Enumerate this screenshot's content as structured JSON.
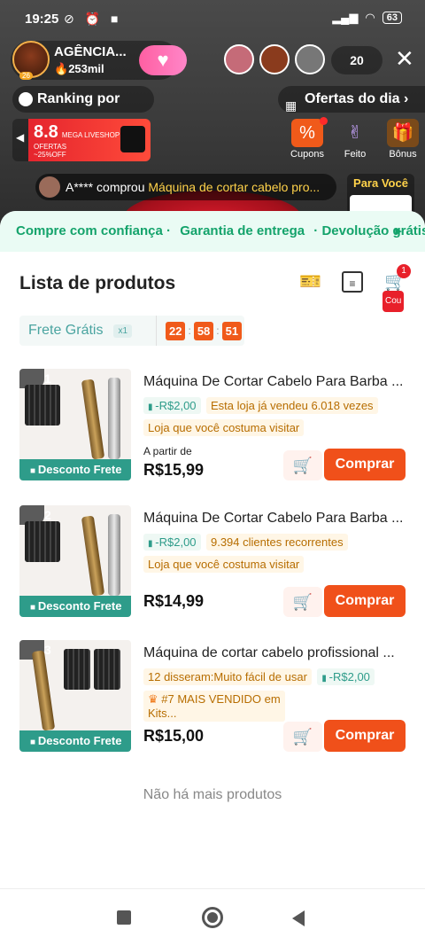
{
  "status": {
    "time": "19:25",
    "battery": "63"
  },
  "live": {
    "host_name": "AGÊNCIA...",
    "host_level": "26",
    "views": "253mil",
    "viewer_count": "20",
    "ranking_label": "Ranking por Hora",
    "offers_label": "Ofertas do dia",
    "banner": {
      "line1": "8.8",
      "line2": "MEGA LIVESHOP DE OFERTAS",
      "line3": "~25%OFF"
    },
    "tiles": [
      {
        "label": "Cupons",
        "icon": "%"
      },
      {
        "label": "Feito",
        "icon": "✌"
      },
      {
        "label": "Bônus",
        "icon": "🎁"
      }
    ],
    "purchase": {
      "user": "A****",
      "text": " comprou ",
      "item": "Máquina de cortar cabelo pro..."
    },
    "para_voce": "Para Você"
  },
  "sheet": {
    "trust": [
      "Compre com confiança ·",
      "Garantia de entrega",
      "· Devolução grátis"
    ],
    "title": "Lista de produtos",
    "cart_count": "1",
    "cart_label": "Cou",
    "frete_label": "Frete Grátis",
    "frete_mult": "x1",
    "timer": [
      "22",
      "58",
      "51"
    ],
    "buy_label": "Comprar",
    "no_more": "Não há mais produtos",
    "products": [
      {
        "rank": "1",
        "tag": "Desconto Frete",
        "name": "Máquina De Cortar Cabelo Para Barba ...",
        "chip_discount": "-R$2,00",
        "chip_info": "Esta loja já vendeu 6.018 vezes",
        "chip_store": "Loja que você costuma visitar",
        "from": "A partir de",
        "price": "R$15,99"
      },
      {
        "rank": "2",
        "tag": "Desconto Frete",
        "name": "Máquina De Cortar Cabelo Para Barba ...",
        "chip_discount": "-R$2,00",
        "chip_info": "9.394 clientes recorrentes",
        "chip_store": "Loja que você costuma visitar",
        "price": "R$14,99"
      },
      {
        "rank": "3",
        "tag": "Desconto Frete",
        "name": "Máquina de cortar cabelo profissional ...",
        "chip_info": "12 disseram:Muito fácil de usar",
        "chip_discount": "-R$2,00",
        "chip_store": "#7 MAIS VENDIDO em Kits...",
        "price": "R$15,00"
      }
    ]
  }
}
